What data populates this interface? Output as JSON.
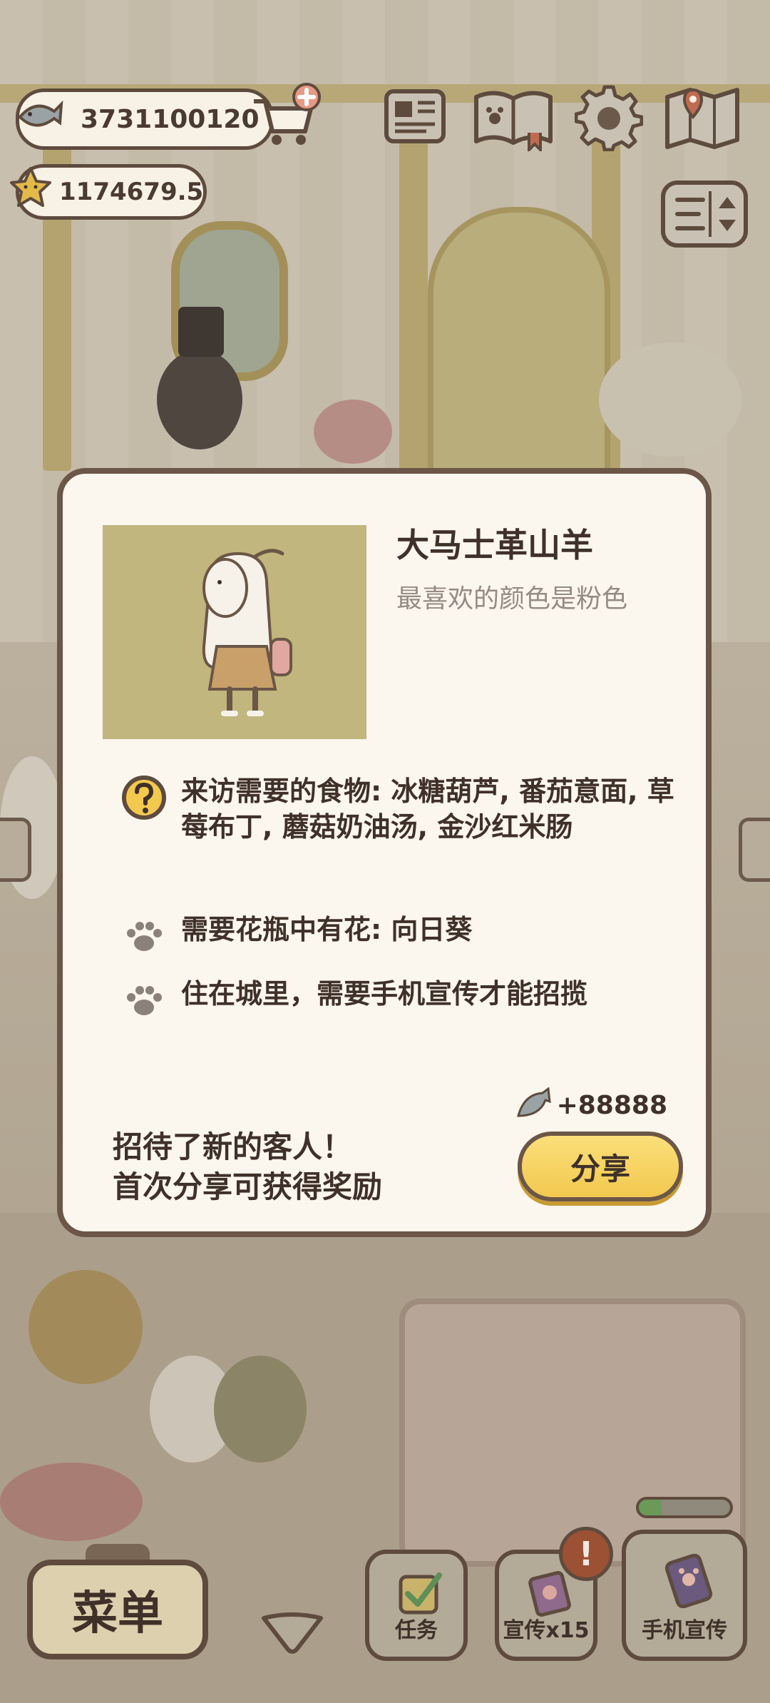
{
  "hud": {
    "fish_count": "3731100120",
    "star_count": "1174679.5",
    "icons": [
      "fish-icon",
      "star-icon",
      "cart-add-icon",
      "newspaper-icon",
      "paw-book-icon",
      "gear-icon",
      "map-icon",
      "sort-icon"
    ]
  },
  "dialog": {
    "name": "大马士革山羊",
    "subtitle": "最喜欢的颜色是粉色",
    "requirements": [
      {
        "icon": "question-icon",
        "text": "来访需要的食物: 冰糖葫芦, 番茄意面, 草莓布丁, 蘑菇奶油汤, 金沙红米肠"
      },
      {
        "icon": "paw-icon",
        "text": "需要花瓶中有花: 向日葵"
      },
      {
        "icon": "paw-icon",
        "text": "住在城里，需要手机宣传才能招揽"
      }
    ],
    "reward": "+88888",
    "message_line1": "招待了新的客人！",
    "message_line2": "首次分享可获得奖励",
    "share_label": "分享"
  },
  "bottom": {
    "menu_label": "菜单",
    "task_label": "任务",
    "promo_label": "宣传x15",
    "phone_label": "手机宣传",
    "alert_glyph": "!",
    "progress": 0.25
  },
  "colors": {
    "panel_bg": "#fbf6ee",
    "border": "#6b5647",
    "button_yellow": "#f2c84f",
    "text_dark": "#3f3129",
    "text_muted": "#958b84",
    "portrait_bg": "#c1b67d"
  }
}
